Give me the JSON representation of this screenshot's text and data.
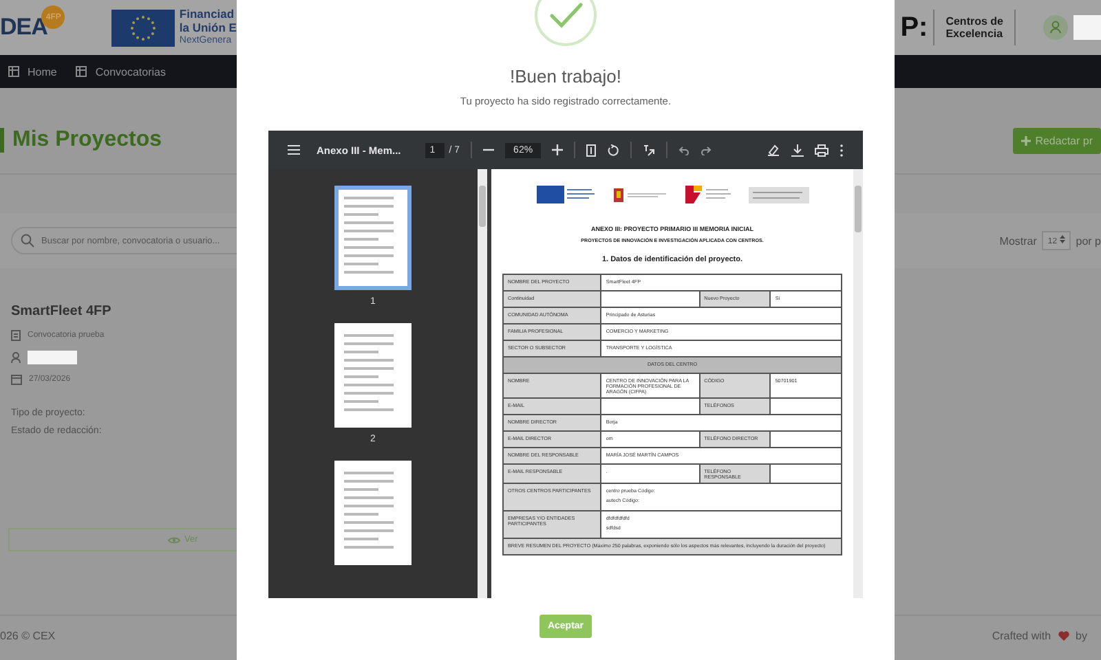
{
  "header": {
    "logo": {
      "text": "DEA",
      "badge": "4FP"
    },
    "funding_lines": [
      "Financiad",
      "la Unión E",
      "NextGenera"
    ],
    "partner_mark": "P:",
    "partner_logo": [
      "Centros de",
      "Excelencia"
    ]
  },
  "nav": {
    "items": [
      {
        "label": "Home"
      },
      {
        "label": "Convocatorias"
      }
    ]
  },
  "page": {
    "title": "Mis Proyectos",
    "new_button": "Redactar pr",
    "search": {
      "placeholder": "Buscar por nombre, convocatoria o usuario..."
    },
    "page_size": {
      "label": "Mostrar",
      "value": "12",
      "suffix": "por p"
    }
  },
  "project_card": {
    "title": "SmartFleet 4FP",
    "call": "Convocatoria prueba",
    "date": "27/03/2026",
    "fields": [
      "Tipo de proyecto:",
      "Estado de redacción:"
    ],
    "view_button": "Ver"
  },
  "footer": {
    "copyright": "026 © CEX",
    "credit_prefix": "Crafted with",
    "credit_suffix": "by"
  },
  "modal": {
    "title": "!Buen trabajo!",
    "message": "Tu proyecto ha sido registrado correctamente.",
    "accept_button": "Aceptar",
    "pdf_viewer": {
      "file_name": "Anexo III - Mem...",
      "page": "1",
      "page_total": "/ 7",
      "zoom": "62%",
      "thumbnails": [
        {
          "label": "1",
          "selected": true
        },
        {
          "label": "2",
          "selected": false
        },
        {
          "selected": false
        }
      ],
      "document": {
        "heading": "ANEXO III: PROYECTO PRIMARIO III MEMORIA INICIAL",
        "subheading": "PROYECTOS DE INNOVACIÓN E INVESTIGACIÓN APLICADA CON CENTROS.",
        "section": "1. Datos de identificación del proyecto.",
        "table": [
          [
            {
              "kind": "label",
              "text": "NOMBRE DEL PROYECTO"
            },
            {
              "kind": "wide",
              "text": "SmartFleet 4FP"
            }
          ],
          [
            {
              "kind": "label",
              "text": "Continuidad"
            },
            {
              "kind": "value"
            },
            {
              "kind": "label",
              "text": "Nuevo Proyecto"
            },
            {
              "kind": "value",
              "text": "Sí"
            }
          ],
          [
            {
              "kind": "label",
              "text": "COMUNIDAD AUTÓNOMA"
            },
            {
              "kind": "wide",
              "text": "Principado de Asturias"
            }
          ],
          [
            {
              "kind": "label",
              "text": "FAMILIA PROFESIONAL"
            },
            {
              "kind": "wide",
              "text": "COMERCIO Y MARKETING"
            }
          ],
          [
            {
              "kind": "label",
              "text": "SECTOR O SUBSECTOR"
            },
            {
              "kind": "wide",
              "text": "TRANSPORTE Y LOGÍSTICA"
            }
          ],
          [
            {
              "kind": "header",
              "text": "DATOS DEL CENTRO"
            }
          ],
          [
            {
              "kind": "label",
              "text": "NOMBRE"
            },
            {
              "kind": "value",
              "text": "CENTRO DE INNOVACIÓN PARA LA FORMACIÓN PROFESIONAL DE ARAGÓN (CIFPA)"
            },
            {
              "kind": "label",
              "text": "CÓDIGO"
            },
            {
              "kind": "value",
              "text": "50701901"
            }
          ],
          [
            {
              "kind": "label",
              "text": "E-MAIL"
            },
            {
              "kind": "value"
            },
            {
              "kind": "label",
              "text": "TELÉFONOS"
            },
            {
              "kind": "value"
            }
          ],
          [
            {
              "kind": "label",
              "text": "NOMBRE DIRECTOR"
            },
            {
              "kind": "wide",
              "text": "Borja"
            }
          ],
          [
            {
              "kind": "label",
              "text": "E-MAIL DIRECTOR"
            },
            {
              "kind": "value",
              "text": "om"
            },
            {
              "kind": "label",
              "text": "TELÉFONO DIRECTOR"
            },
            {
              "kind": "value"
            }
          ],
          [
            {
              "kind": "label",
              "text": "NOMBRE DEL RESPONSABLE"
            },
            {
              "kind": "wide",
              "text": "MARÍA JOSÉ MARTÍN CAMPOS"
            }
          ],
          [
            {
              "kind": "label",
              "text": "E-MAIL RESPONSABLE"
            },
            {
              "kind": "value",
              "text": "."
            },
            {
              "kind": "label",
              "text": "TELÉFONO RESPONSABLE"
            },
            {
              "kind": "value"
            }
          ],
          [
            {
              "kind": "label",
              "text": "OTROS CENTROS PARTICIPANTES"
            },
            {
              "kind": "wide",
              "lines": [
                "centro prueba Código:",
                "autech Código:"
              ]
            }
          ],
          [
            {
              "kind": "label",
              "text": "EMPRESAS Y/O ENTIDADES PARTICIPANTES"
            },
            {
              "kind": "wide",
              "lines": [
                "dfdfdfdfdfd",
                "sdfdsd"
              ]
            }
          ],
          [
            {
              "kind": "note",
              "text": "BREVE RESUMEN DEL PROYECTO (Máximo 250 palabras, exponiendo sólo los aspectos más relevantes, incluyendo la duración del proyecto)"
            }
          ]
        ]
      }
    }
  }
}
